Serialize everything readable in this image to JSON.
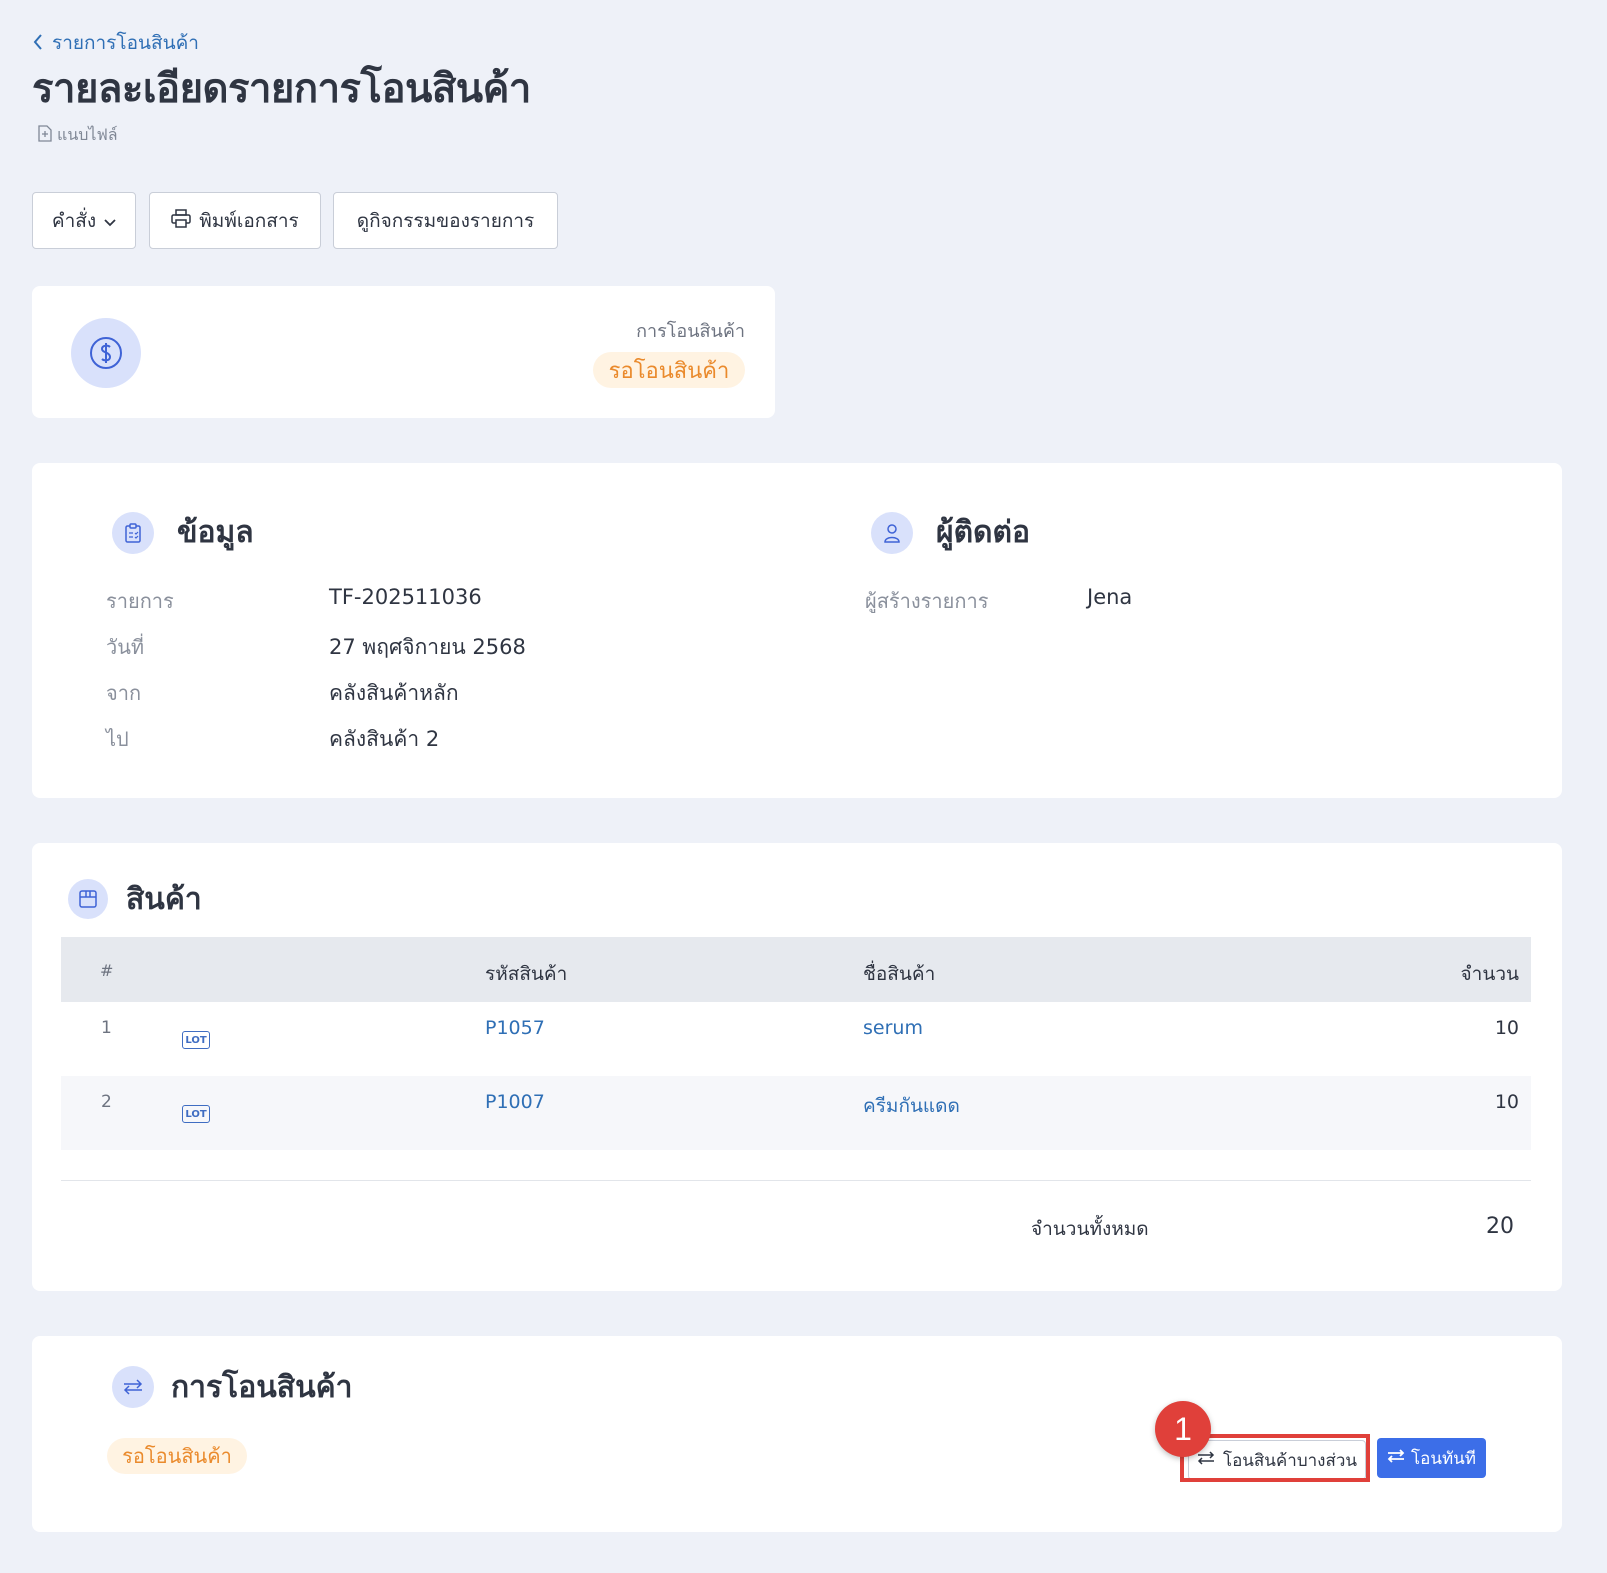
{
  "header": {
    "breadcrumb": "รายการโอนสินค้า",
    "title": "รายละเอียดรายการโอนสินค้า",
    "attach_label": "แนบไฟล์"
  },
  "toolbar": {
    "command_label": "คำสั่ง",
    "print_label": "พิมพ์เอกสาร",
    "activity_label": "ดูกิจกรรมของรายการ"
  },
  "status_card": {
    "caption": "การโอนสินค้า",
    "status": "รอโอนสินค้า"
  },
  "info": {
    "title": "ข้อมูล",
    "fields": [
      {
        "label": "รายการ",
        "value": "TF-202511036"
      },
      {
        "label": "วันที่",
        "value": "27 พฤศจิกายน 2568"
      },
      {
        "label": "จาก",
        "value": "คลังสินค้าหลัก"
      },
      {
        "label": "ไป",
        "value": "คลังสินค้า 2"
      }
    ]
  },
  "contact": {
    "title": "ผู้ติดต่อ",
    "creator_label": "ผู้สร้างรายการ",
    "creator_value": "Jena"
  },
  "products": {
    "title": "สินค้า",
    "columns": {
      "index": "#",
      "code": "รหัสสินค้า",
      "name": "ชื่อสินค้า",
      "qty": "จำนวน"
    },
    "rows": [
      {
        "index": "1",
        "badge": "LOT",
        "code": "P1057",
        "name": "serum",
        "qty": "10"
      },
      {
        "index": "2",
        "badge": "LOT",
        "code": "P1007",
        "name": "ครีมกันแดด",
        "qty": "10"
      }
    ],
    "total_label": "จำนวนทั้งหมด",
    "total_value": "20"
  },
  "transfer": {
    "title": "การโอนสินค้า",
    "status": "รอโอนสินค้า",
    "partial_button": "โอนสินค้าบางส่วน",
    "now_button": "โอนทันที",
    "marker": "1"
  }
}
